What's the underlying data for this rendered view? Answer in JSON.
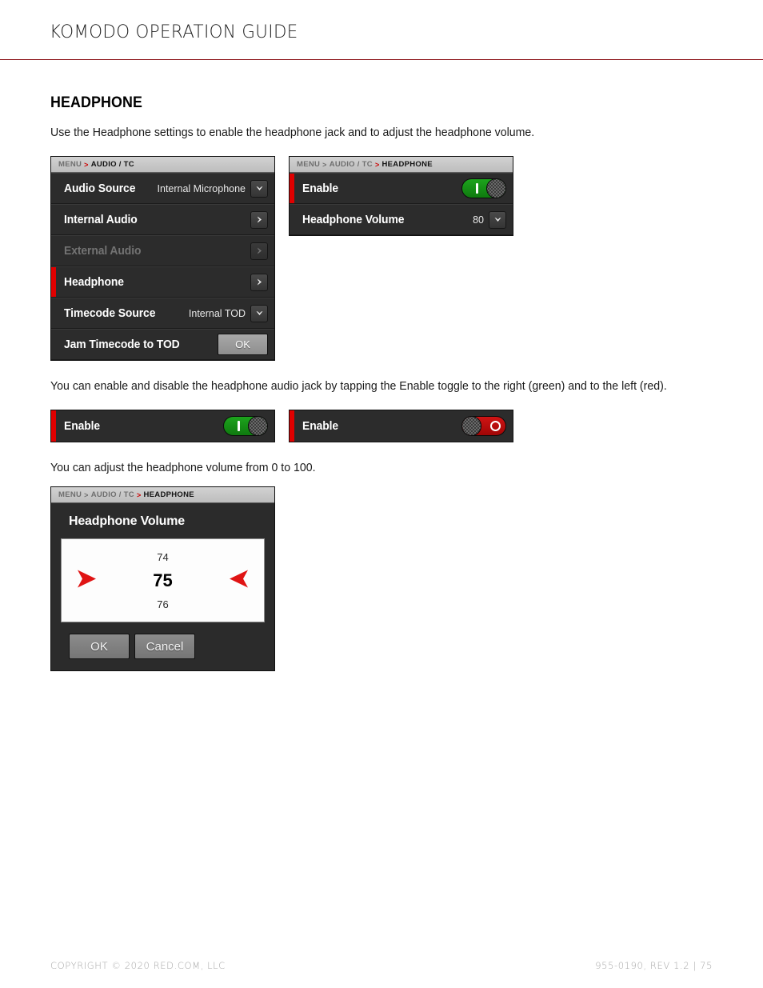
{
  "header": {
    "doc_title": "KOMODO OPERATION GUIDE",
    "rule_color": "#8c1218"
  },
  "section": {
    "title": "HEADPHONE",
    "intro": "Use the Headphone settings to enable the headphone jack and to adjust the headphone volume.",
    "toggle_paragraph": "You can enable and disable the headphone audio jack by tapping the Enable toggle to the right (green) and to the left (red).",
    "volume_paragraph": "You can adjust the headphone volume from 0 to 100."
  },
  "audio_tc_panel": {
    "breadcrumb": {
      "root": "MENU",
      "separator": ">",
      "current": "AUDIO / TC"
    },
    "rows": [
      {
        "label": "Audio Source",
        "value": "Internal Microphone",
        "control": "dropdown",
        "state": "normal",
        "selected": false
      },
      {
        "label": "Internal Audio",
        "value": "",
        "control": "submenu",
        "state": "normal",
        "selected": false
      },
      {
        "label": "External Audio",
        "value": "",
        "control": "submenu",
        "state": "disabled",
        "selected": false
      },
      {
        "label": "Headphone",
        "value": "",
        "control": "submenu",
        "state": "normal",
        "selected": true
      },
      {
        "label": "Timecode Source",
        "value": "Internal TOD",
        "control": "dropdown",
        "state": "normal",
        "selected": false
      },
      {
        "label": "Jam Timecode to TOD",
        "value": "",
        "control": "button",
        "state": "normal",
        "selected": false,
        "button_label": "OK"
      }
    ]
  },
  "headphone_panel": {
    "breadcrumb": {
      "root": "MENU",
      "separator": ">",
      "mid": "AUDIO / TC",
      "red_separator": ">",
      "current": "HEADPHONE"
    },
    "rows": [
      {
        "label": "Enable",
        "control": "toggle",
        "toggle_state": "on",
        "selected": true
      },
      {
        "label": "Headphone Volume",
        "control": "dropdown",
        "value": "80",
        "selected": false
      }
    ]
  },
  "toggle_examples": {
    "enabled": {
      "label": "Enable",
      "state": "on",
      "color": "#1da41d",
      "glyph": "I"
    },
    "disabled": {
      "label": "Enable",
      "state": "off",
      "color": "#d01414",
      "glyph": "O"
    }
  },
  "volume_dialog": {
    "breadcrumb": {
      "root": "MENU",
      "separator": ">",
      "mid": "AUDIO / TC",
      "red_separator": ">",
      "current": "HEADPHONE"
    },
    "title": "Headphone Volume",
    "previous_value": "74",
    "current_value": "75",
    "next_value": "76",
    "ok_label": "OK",
    "cancel_label": "Cancel",
    "arrow_color": "#e01414"
  },
  "footer": {
    "copyright": "COPYRIGHT © 2020 RED.COM, LLC",
    "doc_id": "955-0190, REV 1.2  |  75"
  }
}
